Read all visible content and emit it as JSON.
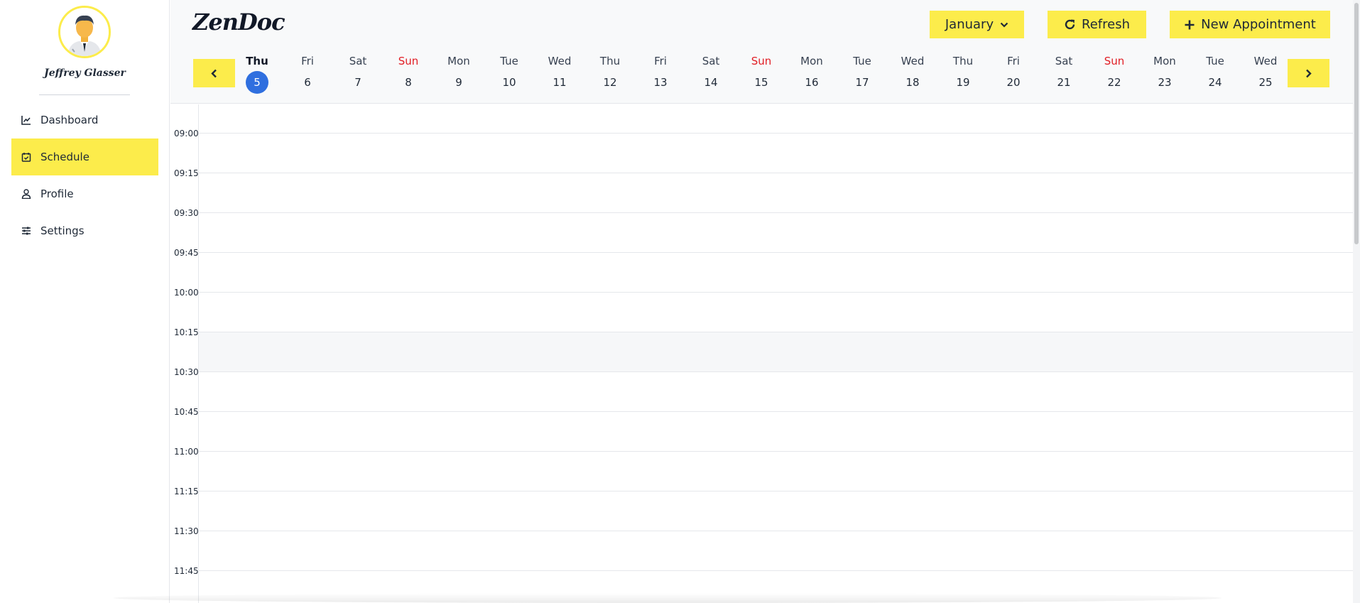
{
  "sidebar": {
    "doctor_name": "Jeffrey Glasser",
    "items": [
      {
        "label": "Dashboard",
        "icon": "chart-line-icon"
      },
      {
        "label": "Schedule",
        "icon": "calendar-check-icon",
        "active": true
      },
      {
        "label": "Profile",
        "icon": "user-icon"
      },
      {
        "label": "Settings",
        "icon": "sliders-icon"
      }
    ]
  },
  "header": {
    "logo": "ZenDoc",
    "month_label": "January",
    "refresh_label": "Refresh",
    "new_appointment_label": "New Appointment"
  },
  "days": [
    {
      "name": "Thu",
      "num": "5"
    },
    {
      "name": "Fri",
      "num": "6"
    },
    {
      "name": "Sat",
      "num": "7"
    },
    {
      "name": "Sun",
      "num": "8"
    },
    {
      "name": "Mon",
      "num": "9"
    },
    {
      "name": "Tue",
      "num": "10"
    },
    {
      "name": "Wed",
      "num": "11"
    },
    {
      "name": "Thu",
      "num": "12"
    },
    {
      "name": "Fri",
      "num": "13"
    },
    {
      "name": "Sat",
      "num": "14"
    },
    {
      "name": "Sun",
      "num": "15"
    },
    {
      "name": "Mon",
      "num": "16"
    },
    {
      "name": "Tue",
      "num": "17"
    },
    {
      "name": "Wed",
      "num": "18"
    },
    {
      "name": "Thu",
      "num": "19"
    },
    {
      "name": "Fri",
      "num": "20"
    },
    {
      "name": "Sat",
      "num": "21"
    },
    {
      "name": "Sun",
      "num": "22"
    },
    {
      "name": "Mon",
      "num": "23"
    },
    {
      "name": "Tue",
      "num": "24"
    },
    {
      "name": "Wed",
      "num": "25"
    }
  ],
  "times": [
    "09:00",
    "09:15",
    "09:30",
    "09:45",
    "10:00",
    "10:15",
    "10:30",
    "10:45",
    "11:00",
    "11:15",
    "11:30",
    "11:45"
  ],
  "colors": {
    "accent": "#fcec4b",
    "today": "#2f6fdf",
    "sunday": "#e11d24"
  }
}
